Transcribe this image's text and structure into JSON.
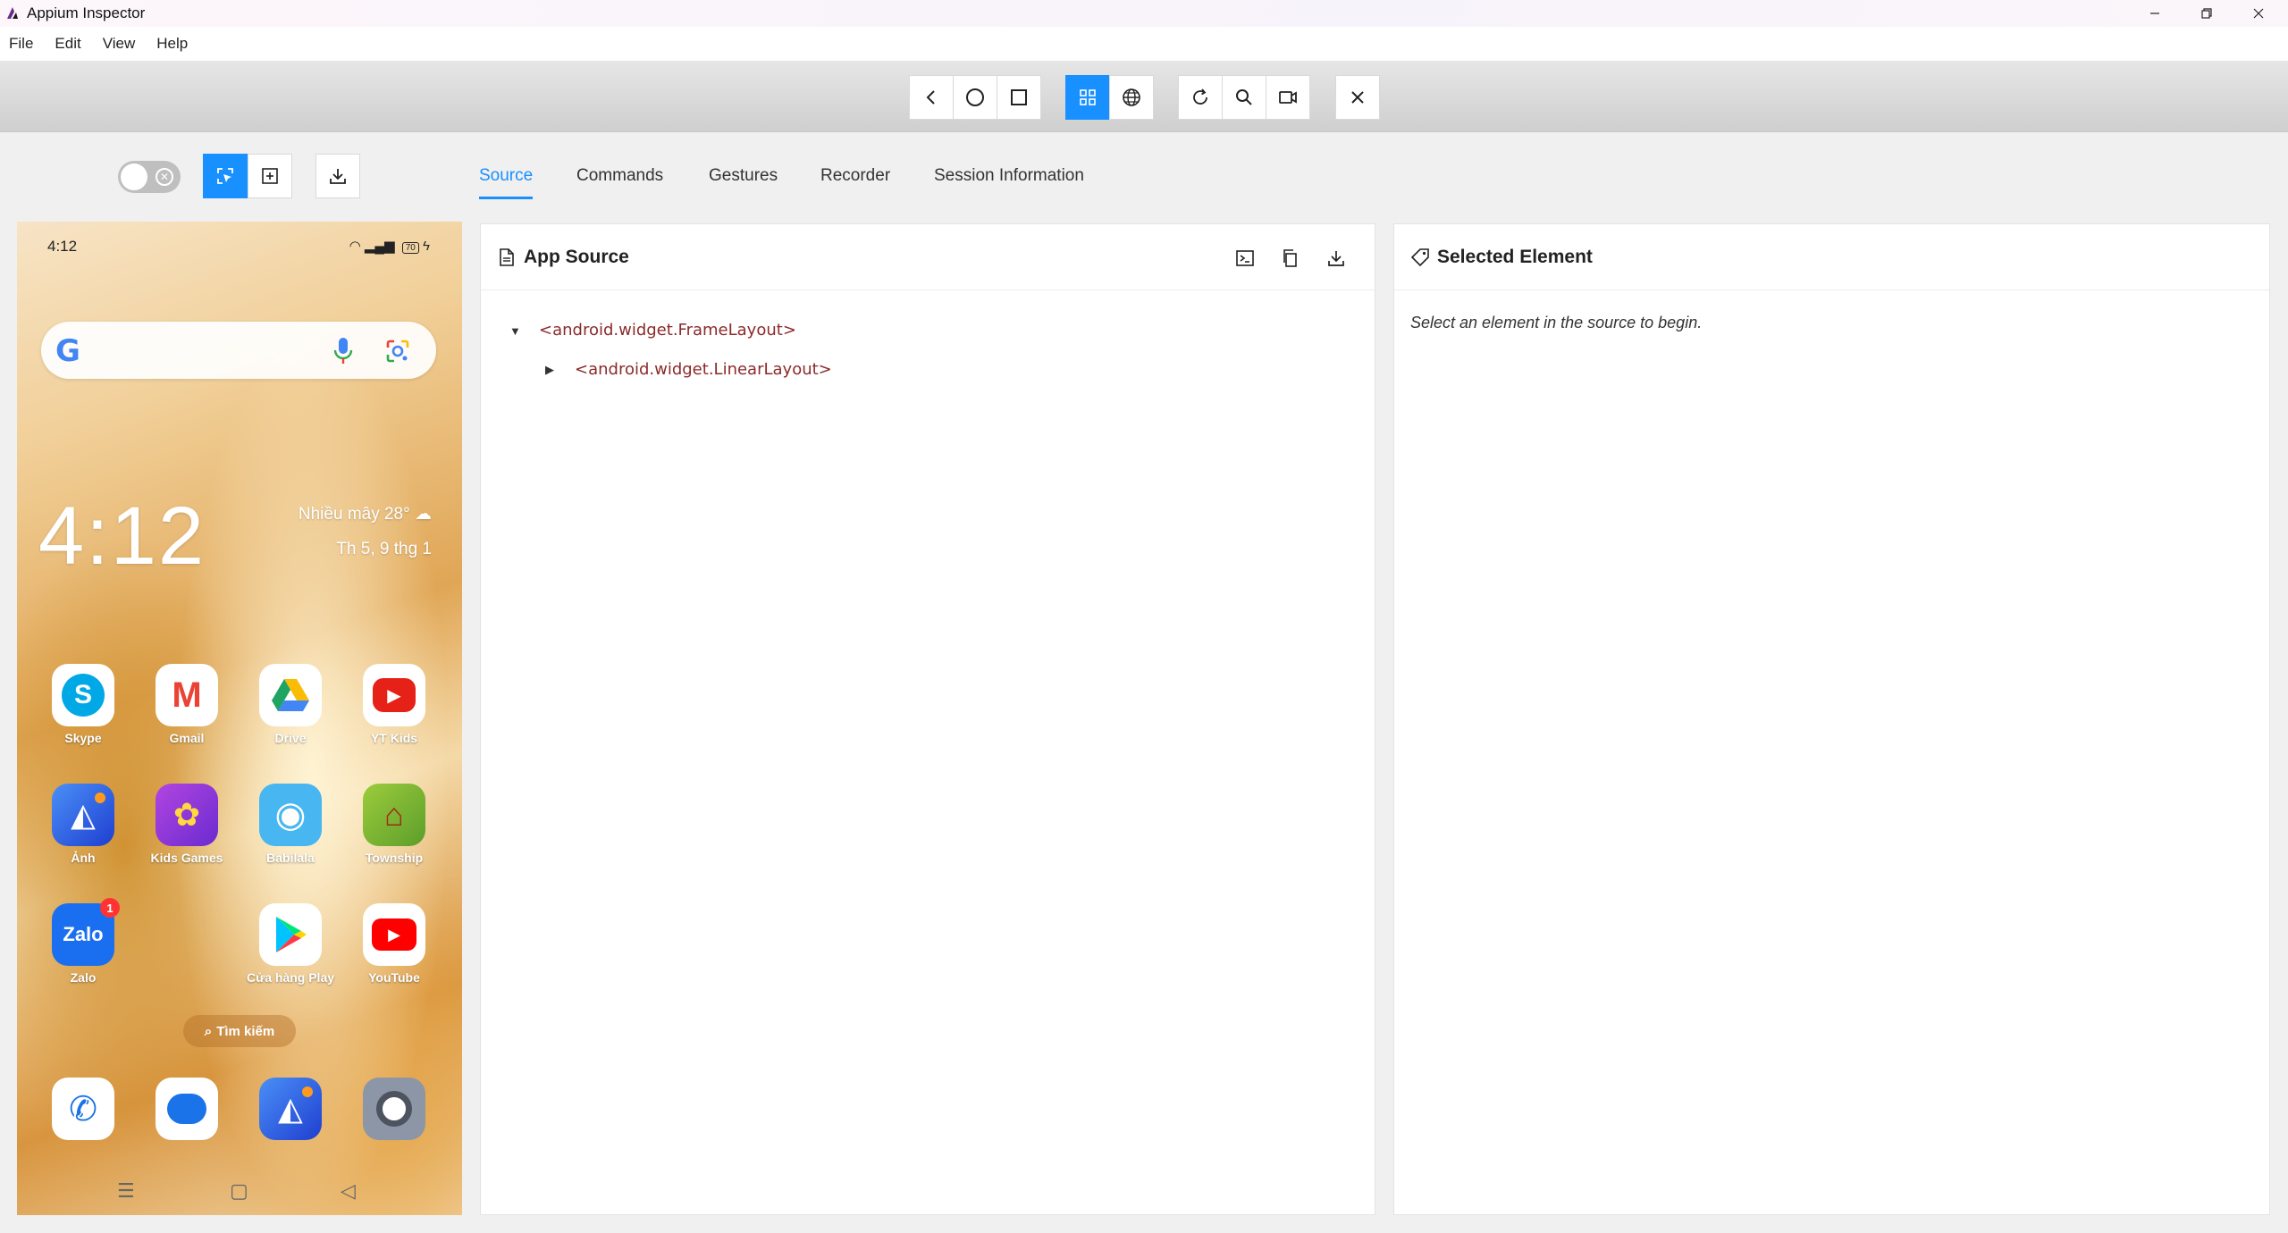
{
  "window": {
    "title": "Appium Inspector",
    "controls": [
      "minimize",
      "restore",
      "close"
    ]
  },
  "menu": [
    "File",
    "Edit",
    "View",
    "Help"
  ],
  "device_toolbar": {
    "buttons": [
      "back",
      "home",
      "app-switch",
      "native-mode",
      "web-mode",
      "refresh",
      "search",
      "record",
      "quit-session"
    ],
    "active": "native-mode"
  },
  "left_controls": {
    "toggle_on": false,
    "buttons": [
      "select-element",
      "tap-coordinates",
      "download-screenshot"
    ],
    "active": "select-element"
  },
  "tabs": [
    {
      "label": "Source"
    },
    {
      "label": "Commands"
    },
    {
      "label": "Gestures"
    },
    {
      "label": "Recorder"
    },
    {
      "label": "Session Information"
    }
  ],
  "active_tab": "Source",
  "phone": {
    "status_time": "4:12",
    "battery": "70",
    "clock": "4:12",
    "weather": "Nhiều mây 28°",
    "date": "Th 5, 9 thg 1",
    "apps": [
      {
        "label": "Skype",
        "icon": "skype-icon",
        "color": "#00a8e6",
        "glyph": "S"
      },
      {
        "label": "Gmail",
        "icon": "gmail-icon",
        "color": "#ffffff",
        "glyph": "M"
      },
      {
        "label": "Drive",
        "icon": "drive-icon",
        "color": "#ffffff",
        "glyph": "▲"
      },
      {
        "label": "YT Kids",
        "icon": "yt-kids-icon",
        "color": "#ffffff",
        "glyph": "▶"
      },
      {
        "label": "Ảnh",
        "icon": "photos-icon",
        "color": "#2b5fe0",
        "glyph": "◭"
      },
      {
        "label": "Kids Games",
        "icon": "kids-games-icon",
        "color": "#8a3fd6",
        "glyph": "✿"
      },
      {
        "label": "Babilala",
        "icon": "babilala-icon",
        "color": "#3aa8e8",
        "glyph": "◉"
      },
      {
        "label": "Township",
        "icon": "township-icon",
        "color": "#8ac43f",
        "glyph": "⌂"
      },
      {
        "label": "Zalo",
        "icon": "zalo-icon",
        "color": "#1a6ff0",
        "glyph": "Zalo",
        "badge": "1"
      },
      {
        "label": "Cửa hàng Play",
        "icon": "play-store-icon",
        "color": "#ffffff",
        "glyph": "▶"
      },
      {
        "label": "YouTube",
        "icon": "youtube-icon",
        "color": "#ffffff",
        "glyph": "▶"
      }
    ],
    "search_pill": "Tìm kiếm",
    "dock": [
      {
        "icon": "phone-icon",
        "color": "#ffffff",
        "glyph": "✆"
      },
      {
        "icon": "messages-icon",
        "color": "#ffffff",
        "glyph": "💬"
      },
      {
        "icon": "gallery-icon",
        "color": "#2b5fe0",
        "glyph": "◭"
      },
      {
        "icon": "camera-icon",
        "color": "#8d96a6",
        "glyph": "◎"
      }
    ]
  },
  "app_source": {
    "title": "App Source",
    "nodes": [
      {
        "text": "<android.widget.FrameLayout>",
        "expanded": true
      },
      {
        "text": "<android.widget.LinearLayout>",
        "expanded": false
      }
    ]
  },
  "selected_element": {
    "title": "Selected Element",
    "hint": "Select an element in the source to begin."
  }
}
